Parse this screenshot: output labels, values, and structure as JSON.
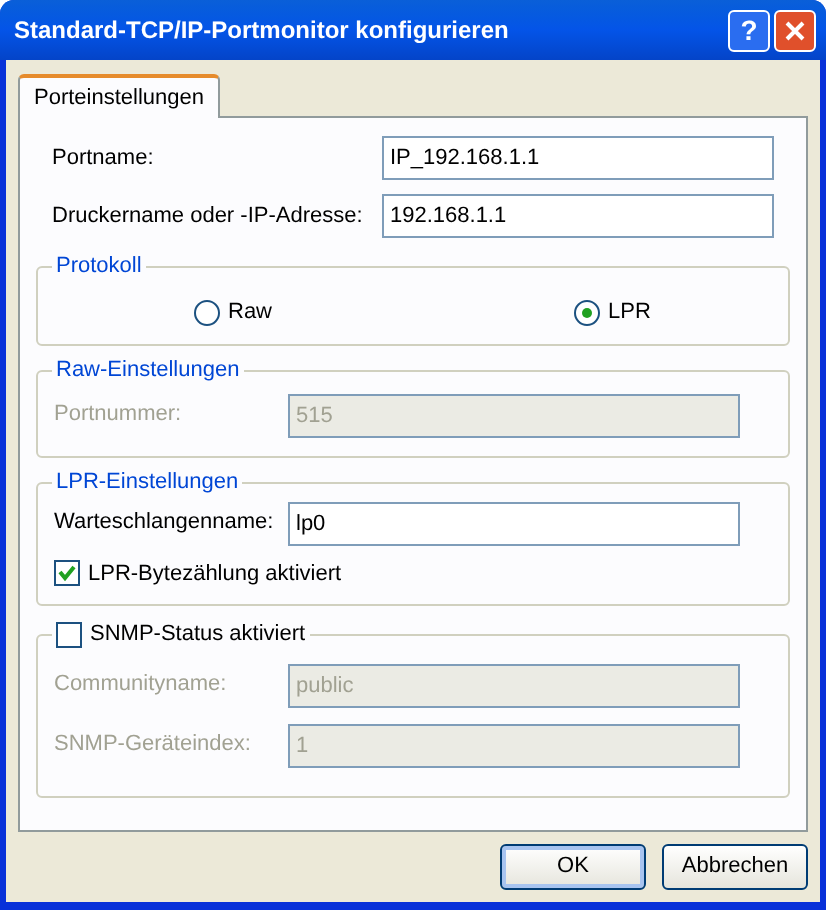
{
  "window": {
    "title": "Standard-TCP/IP-Portmonitor konfigurieren",
    "help_button": "?"
  },
  "tabs": [
    {
      "label": "Porteinstellungen",
      "selected": true
    }
  ],
  "port_name": {
    "label": "Portname:",
    "value": "IP_192.168.1.1"
  },
  "printer_address": {
    "label": "Druckername oder -IP-Adresse:",
    "value": "192.168.1.1"
  },
  "protocol": {
    "title": "Protokoll",
    "options": [
      {
        "label": "Raw",
        "selected": false
      },
      {
        "label": "LPR",
        "selected": true
      }
    ]
  },
  "raw_settings": {
    "title": "Raw-Einstellungen",
    "disabled": true,
    "port_number": {
      "label": "Portnummer:",
      "value": "515"
    }
  },
  "lpr_settings": {
    "title": "LPR-Einstellungen",
    "queue_name": {
      "label": "Warteschlangenname:",
      "value": "lp0"
    },
    "byte_counting": {
      "label": "LPR-Bytezählung aktiviert",
      "checked": true
    }
  },
  "snmp": {
    "label": "SNMP-Status aktiviert",
    "checked": false,
    "community_name": {
      "label": "Communityname:",
      "value": "public"
    },
    "device_index": {
      "label": "SNMP-Geräteindex:",
      "value": "1"
    }
  },
  "buttons": [
    {
      "label": "OK",
      "default": true
    },
    {
      "label": "Abbrechen",
      "default": false
    }
  ]
}
